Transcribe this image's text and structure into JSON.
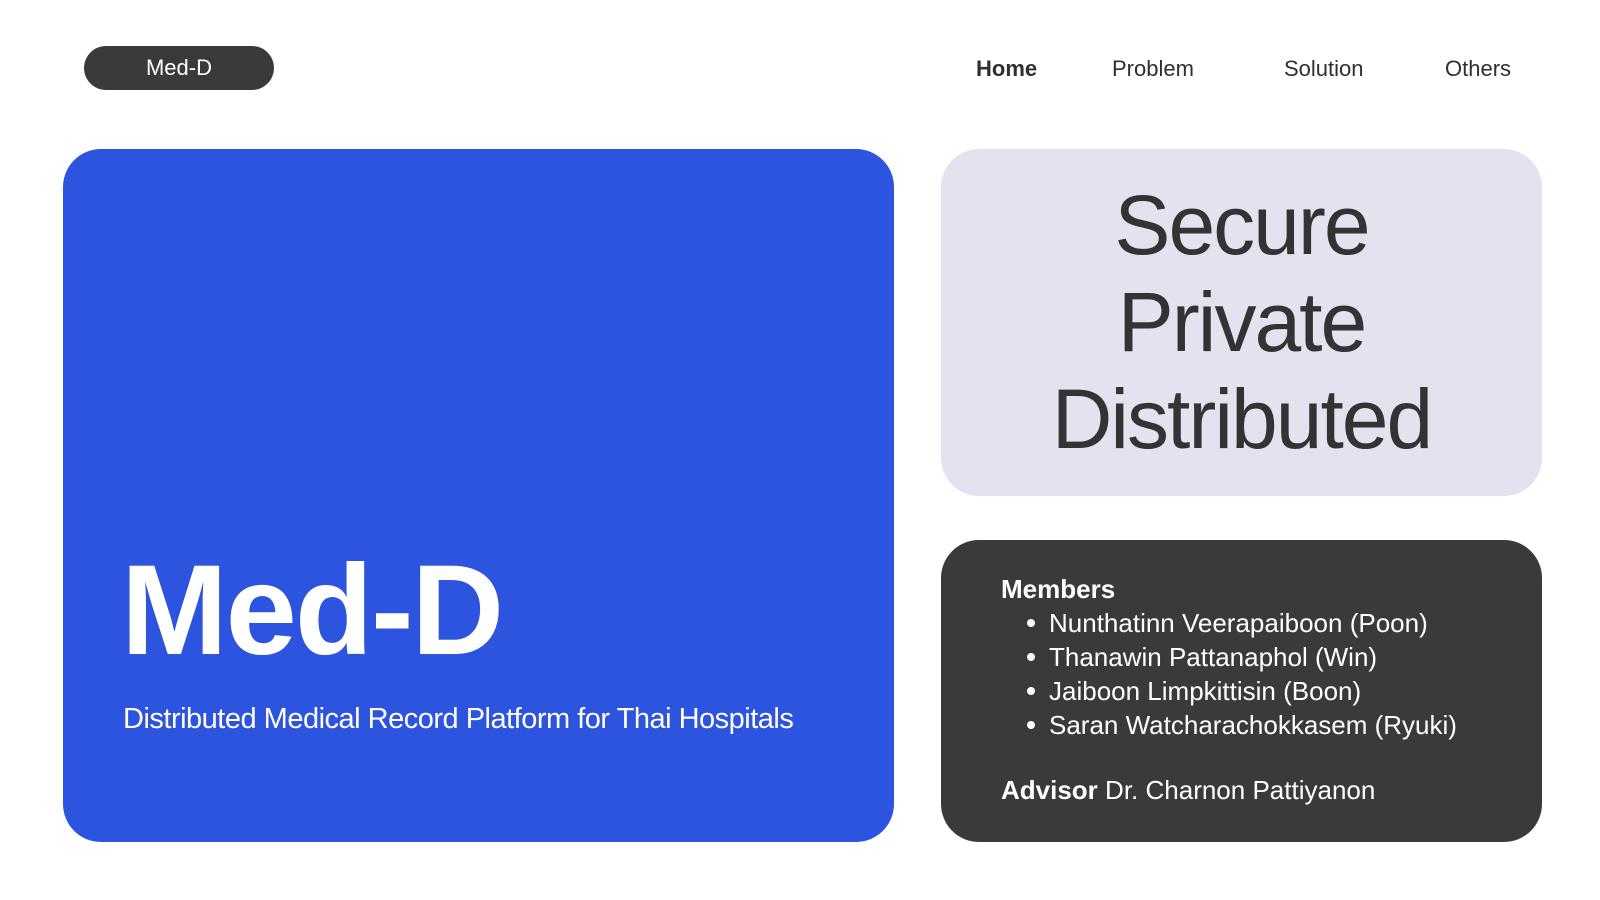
{
  "header": {
    "logo_label": "Med-D",
    "nav": {
      "home": "Home",
      "problem": "Problem",
      "solution": "Solution",
      "others": "Others"
    },
    "active_nav": "Home"
  },
  "hero": {
    "title": "Med-D",
    "subtitle": "Distributed Medical Record Platform for Thai Hospitals",
    "background_color": "#2c54de"
  },
  "tagline": {
    "lines": [
      "Secure",
      "Private",
      "Distributed"
    ],
    "background_color": "#e4e2ee"
  },
  "team": {
    "members_heading": "Members",
    "members": [
      "Nunthatinn Veerapaiboon (Poon)",
      "Thanawin Pattanaphol (Win)",
      "Jaiboon Limpkittisin (Boon)",
      "Saran Watcharachokkasem (Ryuki)"
    ],
    "advisor_label": "Advisor",
    "advisor_name": "Dr. Charnon Pattiyanon",
    "background_color": "#3a3a3a"
  }
}
